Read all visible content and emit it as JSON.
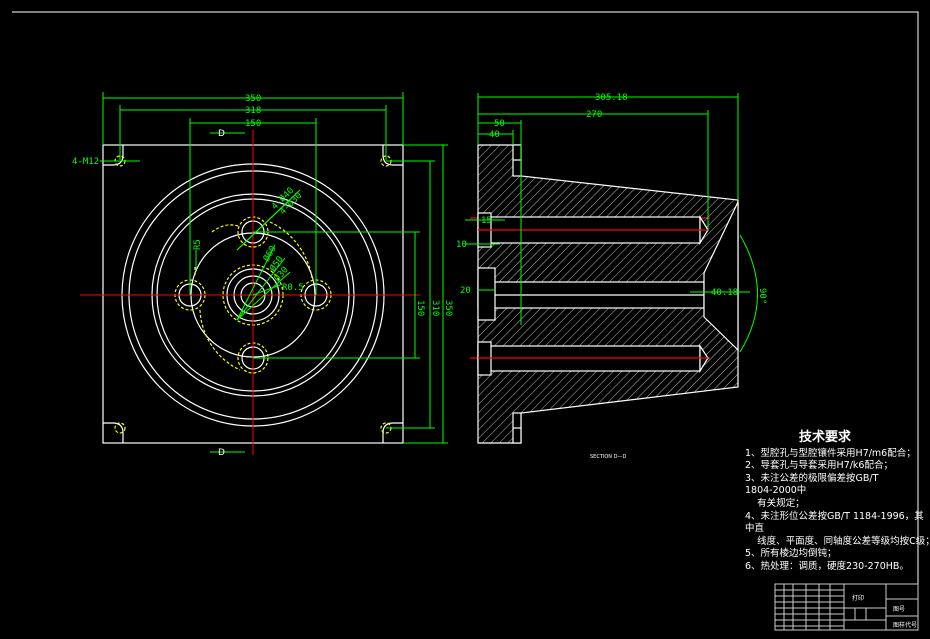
{
  "front_view": {
    "dims_horizontal": [
      "350",
      "318",
      "150"
    ],
    "dims_vertical": [
      "150",
      "310",
      "350"
    ],
    "bolt_label": "4-M12",
    "section_mark": "D",
    "hole_labels": [
      "4-Ø40",
      "4-Ø30",
      "Ø60",
      "Ø50",
      "Ø30",
      "R0.5",
      "R5"
    ]
  },
  "section_view": {
    "dims": [
      "305.18",
      "270",
      "50",
      "40",
      "15",
      "10",
      "20",
      "40.18",
      "90°"
    ],
    "label": "SECTION D—D"
  },
  "requirements": {
    "title": "技术要求",
    "lines": [
      "1、型腔孔与型腔镶件采用H7/m6配合；",
      "2、导套孔与导套采用H7/k6配合；",
      "3、未注公差的极限偏差按GB/T",
      "1804-2000中",
      "    有关规定；",
      "4、未注形位公差按GB/T 1184-1996，其",
      "中直",
      "    线度、平面度、同轴度公差等级均按C级；",
      "5、所有棱边均倒钝；",
      "6、热处理：调质，硬度230-270HB。"
    ]
  },
  "title_block": {
    "name": "打印",
    "field_a": "图号",
    "field_b": "图样代号"
  },
  "colors": {
    "outline": "#ffffff",
    "dim": "#00ff00",
    "center": "#ff0000",
    "hidden": "#ffff00"
  }
}
